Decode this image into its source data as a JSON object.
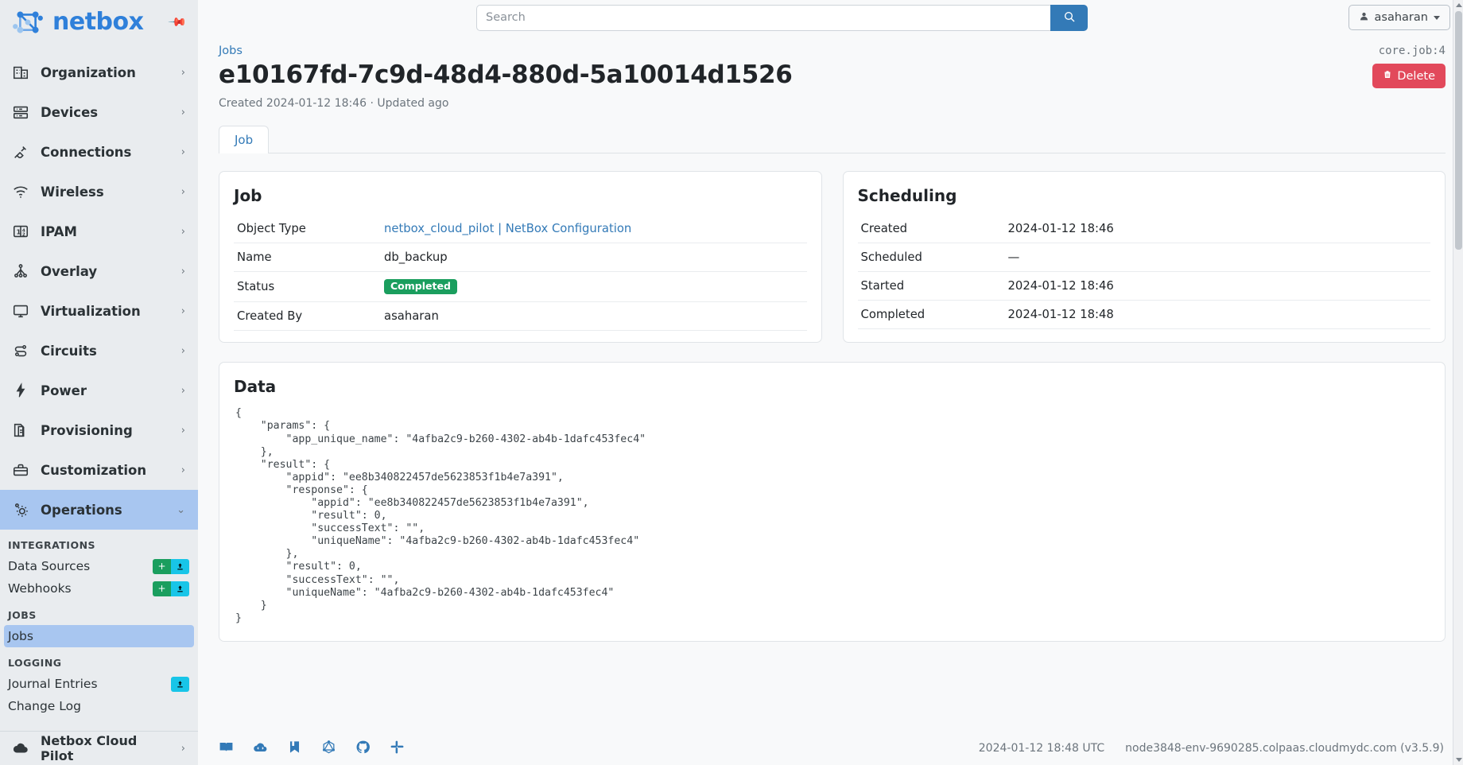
{
  "brand": {
    "name": "netbox",
    "pin_icon": "pin-icon"
  },
  "sidebar": {
    "items": [
      {
        "label": "Organization",
        "icon": "building-icon",
        "chevron": "›"
      },
      {
        "label": "Devices",
        "icon": "server-icon",
        "chevron": "›"
      },
      {
        "label": "Connections",
        "icon": "plug-icon",
        "chevron": "›"
      },
      {
        "label": "Wireless",
        "icon": "wifi-icon",
        "chevron": "›"
      },
      {
        "label": "IPAM",
        "icon": "numbers-icon",
        "chevron": "›"
      },
      {
        "label": "Overlay",
        "icon": "network-tree-icon",
        "chevron": "›"
      },
      {
        "label": "Virtualization",
        "icon": "monitor-icon",
        "chevron": "›"
      },
      {
        "label": "Circuits",
        "icon": "circuit-icon",
        "chevron": "›"
      },
      {
        "label": "Power",
        "icon": "bolt-icon",
        "chevron": "›"
      },
      {
        "label": "Provisioning",
        "icon": "document-icon",
        "chevron": "›"
      },
      {
        "label": "Customization",
        "icon": "toolbox-icon",
        "chevron": "›"
      },
      {
        "label": "Operations",
        "icon": "gears-icon",
        "chevron": "⌄",
        "active": true
      }
    ],
    "groups": [
      {
        "heading": "INTEGRATIONS",
        "items": [
          {
            "label": "Data Sources",
            "add": "+",
            "import": "import-icon"
          },
          {
            "label": "Webhooks",
            "add": "+",
            "import": "import-icon"
          }
        ]
      },
      {
        "heading": "JOBS",
        "items": [
          {
            "label": "Jobs",
            "active": true
          }
        ]
      },
      {
        "heading": "LOGGING",
        "items": [
          {
            "label": "Journal Entries",
            "import": "import-icon"
          },
          {
            "label": "Change Log"
          }
        ]
      }
    ],
    "cloud_pilot": {
      "label": "Netbox Cloud Pilot",
      "icon": "cloud-icon",
      "chevron": "›"
    }
  },
  "topbar": {
    "search_placeholder": "Search",
    "search_value": "",
    "search_button_icon": "search-icon",
    "user_name": "asaharan",
    "user_icon": "person-icon"
  },
  "header": {
    "breadcrumb": "Jobs",
    "object_id": "core.job:4",
    "title": "e10167fd-7c9d-48d4-880d-5a10014d1526",
    "delete_label": "Delete",
    "delete_icon": "trash-icon",
    "meta": "Created 2024-01-12 18:46 · Updated ago"
  },
  "tabs": [
    {
      "label": "Job",
      "active": true
    }
  ],
  "job_card": {
    "title": "Job",
    "rows": [
      {
        "key": "Object Type",
        "value": "netbox_cloud_pilot | NetBox Configuration",
        "type": "link"
      },
      {
        "key": "Name",
        "value": "db_backup",
        "type": "text"
      },
      {
        "key": "Status",
        "value": "Completed",
        "type": "badge",
        "color": "#1a9e5e"
      },
      {
        "key": "Created By",
        "value": "asaharan",
        "type": "text"
      }
    ]
  },
  "scheduling_card": {
    "title": "Scheduling",
    "rows": [
      {
        "key": "Created",
        "value": "2024-01-12 18:46"
      },
      {
        "key": "Scheduled",
        "value": "—"
      },
      {
        "key": "Started",
        "value": "2024-01-12 18:46"
      },
      {
        "key": "Completed",
        "value": "2024-01-12 18:48"
      }
    ]
  },
  "data_card": {
    "title": "Data",
    "json": "{\n    \"params\": {\n        \"app_unique_name\": \"4afba2c9-b260-4302-ab4b-1dafc453fec4\"\n    },\n    \"result\": {\n        \"appid\": \"ee8b340822457de5623853f1b4e7a391\",\n        \"response\": {\n            \"appid\": \"ee8b340822457de5623853f1b4e7a391\",\n            \"result\": 0,\n            \"successText\": \"\",\n            \"uniqueName\": \"4afba2c9-b260-4302-ab4b-1dafc453fec4\"\n        },\n        \"result\": 0,\n        \"successText\": \"\",\n        \"uniqueName\": \"4afba2c9-b260-4302-ab4b-1dafc453fec4\"\n    }\n}"
  },
  "footer": {
    "icons": [
      "docs-book-icon",
      "api-cloud-icon",
      "bookmark-icon",
      "graphql-icon",
      "github-icon",
      "slack-icon"
    ],
    "timestamp": "2024-01-12 18:48 UTC",
    "host": "node3848-env-9690285.colpaas.cloudmydc.com (v3.5.9)"
  }
}
